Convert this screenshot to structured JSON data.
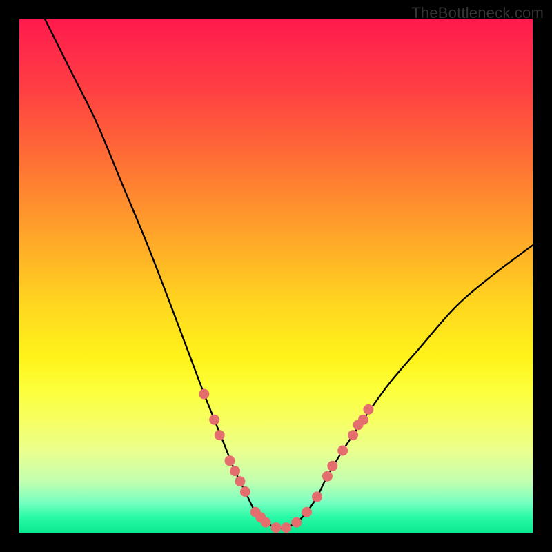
{
  "watermark": "TheBottleneck.com",
  "colors": {
    "frame": "#000000",
    "gradient_top": "#ff1a4d",
    "gradient_bottom": "#0be890",
    "curve": "#000000",
    "marker_fill": "#e46e6e",
    "marker_stroke": "#c94f4f"
  },
  "chart_data": {
    "type": "line",
    "title": "",
    "xlabel": "",
    "ylabel": "",
    "xlim": [
      0,
      100
    ],
    "ylim": [
      0,
      100
    ],
    "grid": false,
    "legend": false,
    "comment": "V-shaped bottleneck curve. y ≈ 0 is optimal (green band at bottom). Left branch descends steeply from top-left into the valley near x≈45–55, right branch ascends toward top-right ending around y≈55 at x=100. Salmon dots mark observed points clustered on both flanks near the valley.",
    "series": [
      {
        "name": "bottleneck_curve",
        "x": [
          5,
          10,
          15,
          20,
          25,
          30,
          33,
          36,
          38,
          40,
          42,
          44,
          46,
          48,
          50,
          52,
          54,
          56,
          58,
          60,
          63,
          67,
          72,
          78,
          85,
          92,
          100
        ],
        "y": [
          100,
          90,
          80,
          68,
          56,
          43,
          35,
          27,
          22,
          17,
          12,
          8,
          4,
          2,
          1,
          1,
          2,
          4,
          7,
          11,
          16,
          22,
          29,
          36,
          44,
          50,
          56
        ]
      }
    ],
    "markers": [
      {
        "x": 36,
        "y": 27
      },
      {
        "x": 38,
        "y": 22
      },
      {
        "x": 39,
        "y": 19
      },
      {
        "x": 41,
        "y": 14
      },
      {
        "x": 42,
        "y": 12
      },
      {
        "x": 43,
        "y": 10
      },
      {
        "x": 44,
        "y": 8
      },
      {
        "x": 46,
        "y": 4
      },
      {
        "x": 47,
        "y": 3
      },
      {
        "x": 48,
        "y": 2
      },
      {
        "x": 50,
        "y": 1
      },
      {
        "x": 52,
        "y": 1
      },
      {
        "x": 54,
        "y": 2
      },
      {
        "x": 56,
        "y": 4
      },
      {
        "x": 58,
        "y": 7
      },
      {
        "x": 60,
        "y": 11
      },
      {
        "x": 61,
        "y": 13
      },
      {
        "x": 63,
        "y": 16
      },
      {
        "x": 65,
        "y": 19
      },
      {
        "x": 66,
        "y": 21
      },
      {
        "x": 67,
        "y": 22
      },
      {
        "x": 68,
        "y": 24
      }
    ]
  }
}
